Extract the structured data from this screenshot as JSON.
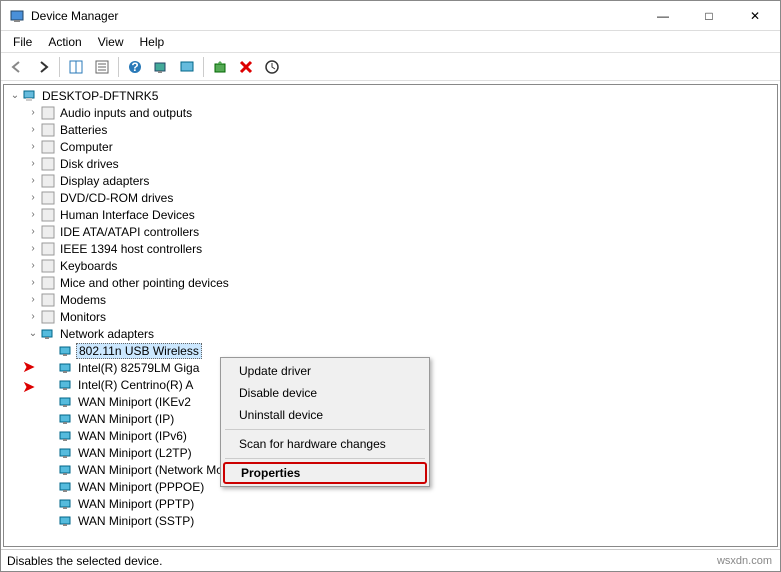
{
  "window": {
    "title": "Device Manager",
    "buttons": {
      "min": "—",
      "max": "□",
      "close": "✕"
    }
  },
  "menubar": [
    "File",
    "Action",
    "View",
    "Help"
  ],
  "toolbar_icons": [
    "back-icon",
    "forward-icon",
    "view-icon",
    "properties-icon",
    "help-icon",
    "scan-icon",
    "monitor-icon",
    "update-icon",
    "uninstall-icon",
    "scanfor-icon"
  ],
  "tree": {
    "root": "DESKTOP-DFTNRK5",
    "categories": [
      {
        "label": "Audio inputs and outputs",
        "expanded": false
      },
      {
        "label": "Batteries",
        "expanded": false
      },
      {
        "label": "Computer",
        "expanded": false
      },
      {
        "label": "Disk drives",
        "expanded": false
      },
      {
        "label": "Display adapters",
        "expanded": false
      },
      {
        "label": "DVD/CD-ROM drives",
        "expanded": false
      },
      {
        "label": "Human Interface Devices",
        "expanded": false
      },
      {
        "label": "IDE ATA/ATAPI controllers",
        "expanded": false
      },
      {
        "label": "IEEE 1394 host controllers",
        "expanded": false
      },
      {
        "label": "Keyboards",
        "expanded": false
      },
      {
        "label": "Mice and other pointing devices",
        "expanded": false
      },
      {
        "label": "Modems",
        "expanded": false
      },
      {
        "label": "Monitors",
        "expanded": false
      },
      {
        "label": "Network adapters",
        "expanded": true,
        "children": [
          {
            "label": "802.11n USB Wireless",
            "selected": true
          },
          {
            "label": "Intel(R) 82579LM Giga"
          },
          {
            "label": "Intel(R) Centrino(R) A"
          },
          {
            "label": "WAN Miniport (IKEv2"
          },
          {
            "label": "WAN Miniport (IP)"
          },
          {
            "label": "WAN Miniport (IPv6)"
          },
          {
            "label": "WAN Miniport (L2TP)"
          },
          {
            "label": "WAN Miniport (Network Monitor)"
          },
          {
            "label": "WAN Miniport (PPPOE)"
          },
          {
            "label": "WAN Miniport (PPTP)"
          },
          {
            "label": "WAN Miniport (SSTP)"
          }
        ]
      }
    ]
  },
  "context_menu": {
    "items": [
      {
        "label": "Update driver"
      },
      {
        "label": "Disable device"
      },
      {
        "label": "Uninstall device"
      },
      {
        "sep": true
      },
      {
        "label": "Scan for hardware changes"
      },
      {
        "sep": true
      },
      {
        "label": "Properties",
        "highlight": true
      }
    ]
  },
  "statusbar": "Disables the selected device.",
  "watermark": "wsxdn.com"
}
